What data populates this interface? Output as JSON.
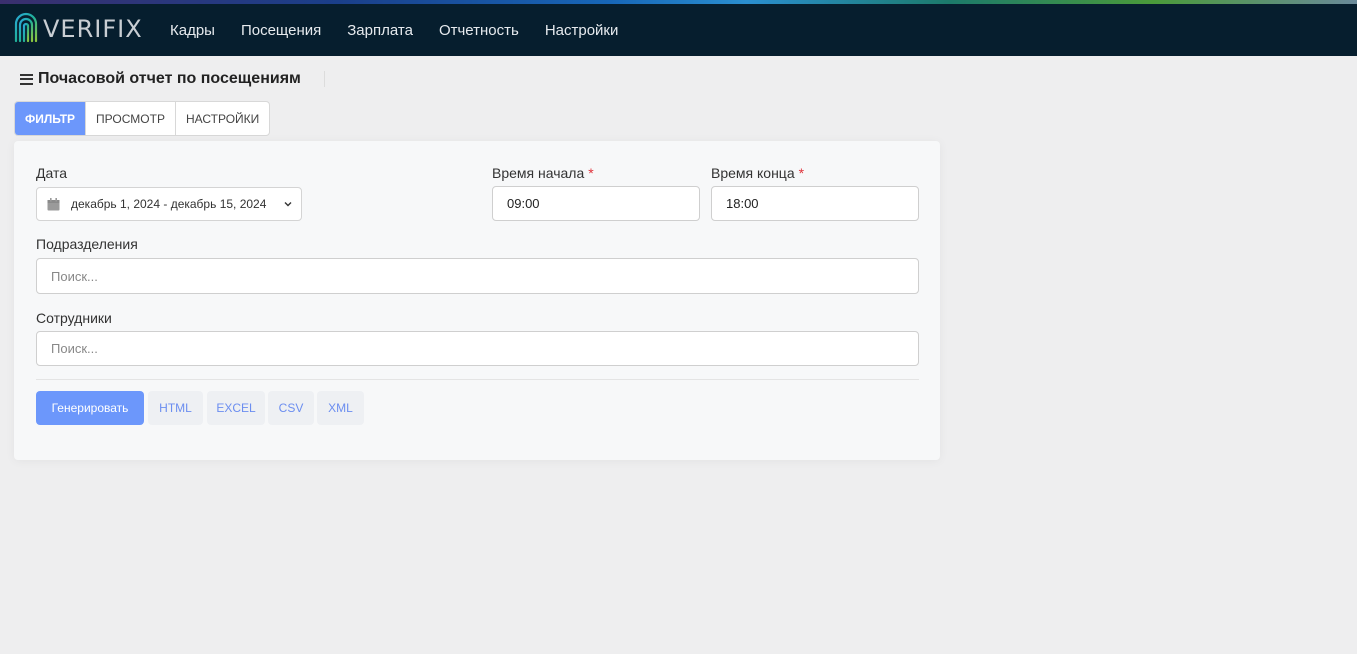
{
  "app": {
    "brand": "VERIFIX",
    "colors": {
      "nav_bg": "#061e2e",
      "accent": "#6c97fb",
      "required": "#e0323a"
    }
  },
  "nav": {
    "items": [
      "Кадры",
      "Посещения",
      "Зарплата",
      "Отчетность",
      "Настройки"
    ]
  },
  "page": {
    "title": "Почасовой отчет по посещениям",
    "menu_icon": "hamburger-icon"
  },
  "tabs": [
    {
      "label": "ФИЛЬТР",
      "active": true
    },
    {
      "label": "ПРОСМОТР",
      "active": false
    },
    {
      "label": "НАСТРОЙКИ",
      "active": false
    }
  ],
  "filter": {
    "date": {
      "label": "Дата",
      "value": "декабрь 1, 2024 - декабрь 15, 2024",
      "icon": "calendar-icon"
    },
    "start_time": {
      "label": "Время начала",
      "required_mark": "*",
      "value": "09:00"
    },
    "end_time": {
      "label": "Время конца",
      "required_mark": "*",
      "value": "18:00"
    },
    "divisions": {
      "label": "Подразделения",
      "placeholder": "Поиск..."
    },
    "employees": {
      "label": "Сотрудники",
      "placeholder": "Поиск..."
    }
  },
  "actions": {
    "generate": "Генерировать",
    "html": "HTML",
    "excel": "EXCEL",
    "csv": "CSV",
    "xml": "XML"
  }
}
